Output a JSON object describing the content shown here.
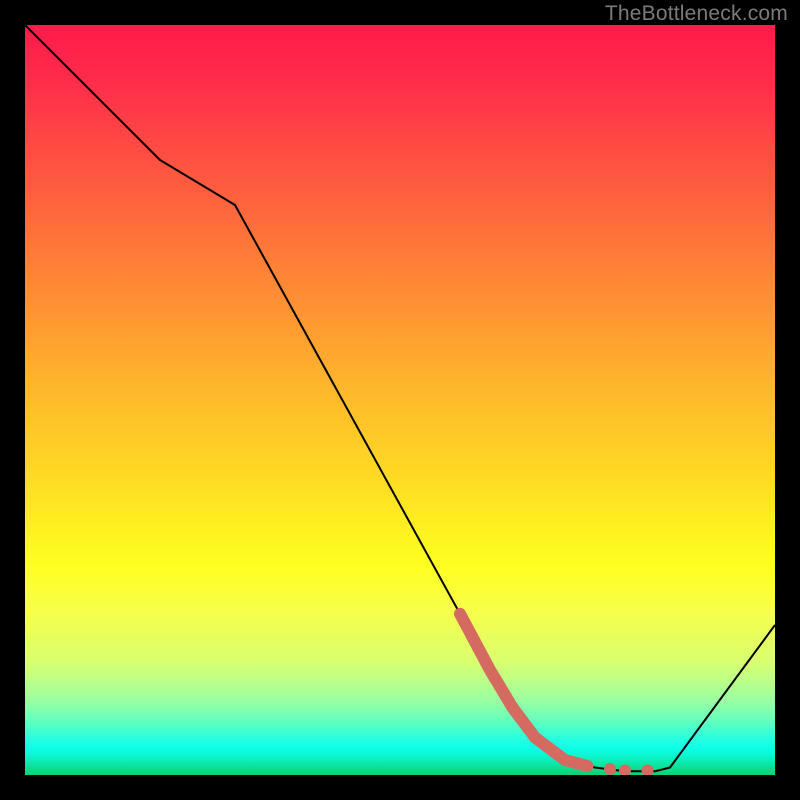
{
  "watermark": "TheBottleneck.com",
  "chart_data": {
    "type": "line",
    "title": "",
    "xlabel": "",
    "ylabel": "",
    "xlim": [
      0,
      100
    ],
    "ylim": [
      0,
      100
    ],
    "grid": false,
    "series": [
      {
        "name": "curve",
        "x": [
          0,
          18,
          28,
          58,
          64,
          68,
          72,
          76,
          80,
          84,
          86,
          100
        ],
        "values": [
          100,
          82,
          76,
          21.5,
          10,
          5,
          2,
          1,
          0.5,
          0.5,
          1,
          20
        ],
        "color": "#000000",
        "stroke_width": 2
      }
    ],
    "highlight_segment": {
      "name": "highlight",
      "x": [
        58,
        62,
        65,
        68,
        70,
        72,
        75,
        78,
        80,
        82
      ],
      "values": [
        21.5,
        14,
        9,
        5,
        3.5,
        2,
        1.2,
        0.8,
        0.6,
        0.6
      ],
      "color": "#d46a60",
      "stroke_width": 12,
      "dots": [
        {
          "x": 78,
          "y": 0.8
        },
        {
          "x": 80,
          "y": 0.6
        },
        {
          "x": 83,
          "y": 0.6
        }
      ]
    },
    "background_gradient": {
      "stops": [
        {
          "pos": 0.0,
          "color": "#ff1a4a"
        },
        {
          "pos": 0.2,
          "color": "#ff5740"
        },
        {
          "pos": 0.47,
          "color": "#ffb22c"
        },
        {
          "pos": 0.72,
          "color": "#feff20"
        },
        {
          "pos": 0.9,
          "color": "#9cffa0"
        },
        {
          "pos": 1.0,
          "color": "#0cd270"
        }
      ]
    }
  }
}
